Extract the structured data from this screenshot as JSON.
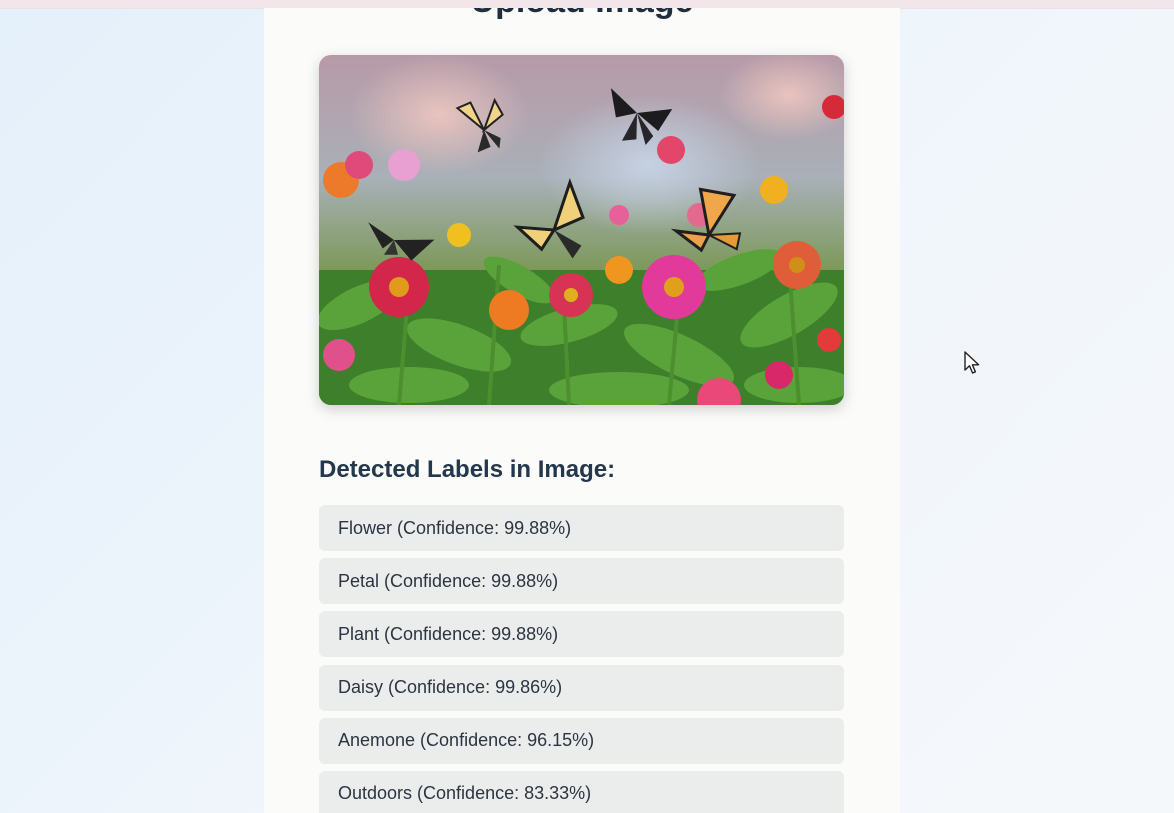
{
  "page": {
    "cut_title": "Upload Image"
  },
  "hero_image": {
    "alt": "Butterflies flying over a colorful field of zinnia flowers"
  },
  "labels_section": {
    "heading": "Detected Labels in Image:",
    "items": [
      {
        "label": "Flower (Confidence: 99.88%)"
      },
      {
        "label": "Petal (Confidence: 99.88%)"
      },
      {
        "label": "Plant (Confidence: 99.88%)"
      },
      {
        "label": "Daisy (Confidence: 99.86%)"
      },
      {
        "label": "Anemone (Confidence: 96.15%)"
      },
      {
        "label": "Outdoors (Confidence: 83.33%)"
      }
    ]
  },
  "colors": {
    "page_background": "#e4f0fa",
    "card_background": "#fbfbfa",
    "label_item_background": "#ebeded",
    "heading_color": "#23374d"
  },
  "icons": {
    "cursor": "mouse-pointer-icon"
  }
}
